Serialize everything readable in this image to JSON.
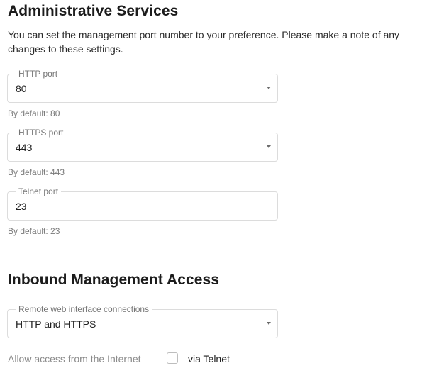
{
  "administrative_services": {
    "title": "Administrative Services",
    "description": "You can set the management port number to your preference. Please make a note of any changes to these settings.",
    "http_port": {
      "label": "HTTP port",
      "value": "80",
      "hint": "By default: 80"
    },
    "https_port": {
      "label": "HTTPS port",
      "value": "443",
      "hint": "By default: 443"
    },
    "telnet_port": {
      "label": "Telnet port",
      "value": "23",
      "hint": "By default: 23"
    }
  },
  "inbound_management_access": {
    "title": "Inbound Management Access",
    "remote_web": {
      "label": "Remote web interface connections",
      "value": "HTTP and HTTPS"
    },
    "internet_access": {
      "label": "Allow access from the Internet",
      "telnet_checkbox_label": "via Telnet",
      "telnet_checked": false
    }
  },
  "icons": {
    "dropdown": "chevron-down-icon"
  }
}
